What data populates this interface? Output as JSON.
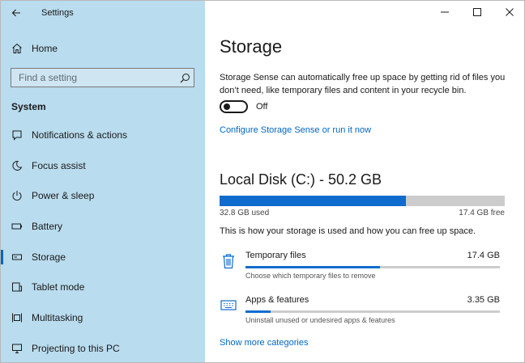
{
  "app": {
    "title": "Settings",
    "back_icon": "back-arrow-icon"
  },
  "sidebar": {
    "home_label": "Home",
    "search_placeholder": "Find a setting",
    "section_title": "System",
    "items": [
      {
        "label": "Notifications & actions",
        "icon": "notifications-icon"
      },
      {
        "label": "Focus assist",
        "icon": "moon-icon"
      },
      {
        "label": "Power & sleep",
        "icon": "power-icon"
      },
      {
        "label": "Battery",
        "icon": "battery-icon"
      },
      {
        "label": "Storage",
        "icon": "storage-icon",
        "selected": true
      },
      {
        "label": "Tablet mode",
        "icon": "tablet-icon"
      },
      {
        "label": "Multitasking",
        "icon": "multitasking-icon"
      },
      {
        "label": "Projecting to this PC",
        "icon": "projector-icon"
      }
    ]
  },
  "main": {
    "title": "Storage",
    "description": "Storage Sense can automatically free up space by getting rid of files you don’t need, like temporary files and content in your recycle bin.",
    "storage_sense_toggle": {
      "state_label": "Off",
      "on": false
    },
    "configure_link": "Configure Storage Sense or run it now",
    "disk": {
      "title": "Local Disk (C:) - 50.2 GB",
      "used_label": "32.8 GB used",
      "free_label": "17.4 GB free",
      "used_fraction": 0.653
    },
    "usage_note": "This is how your storage is used and how you can free up space.",
    "categories": [
      {
        "name": "Temporary files",
        "size": "17.4 GB",
        "subtitle": "Choose which temporary files to remove",
        "fraction": 0.53,
        "icon": "trash-icon"
      },
      {
        "name": "Apps & features",
        "size": "3.35 GB",
        "subtitle": "Uninstall unused or undesired apps & features",
        "fraction": 0.1,
        "icon": "keyboard-icon"
      }
    ],
    "more_link": "Show more categories"
  },
  "colors": {
    "accent": "#0067c0",
    "bar_fill": "#0f6cce",
    "bar_track": "#cccccc",
    "sidebar_bg": "#b9dcee"
  }
}
